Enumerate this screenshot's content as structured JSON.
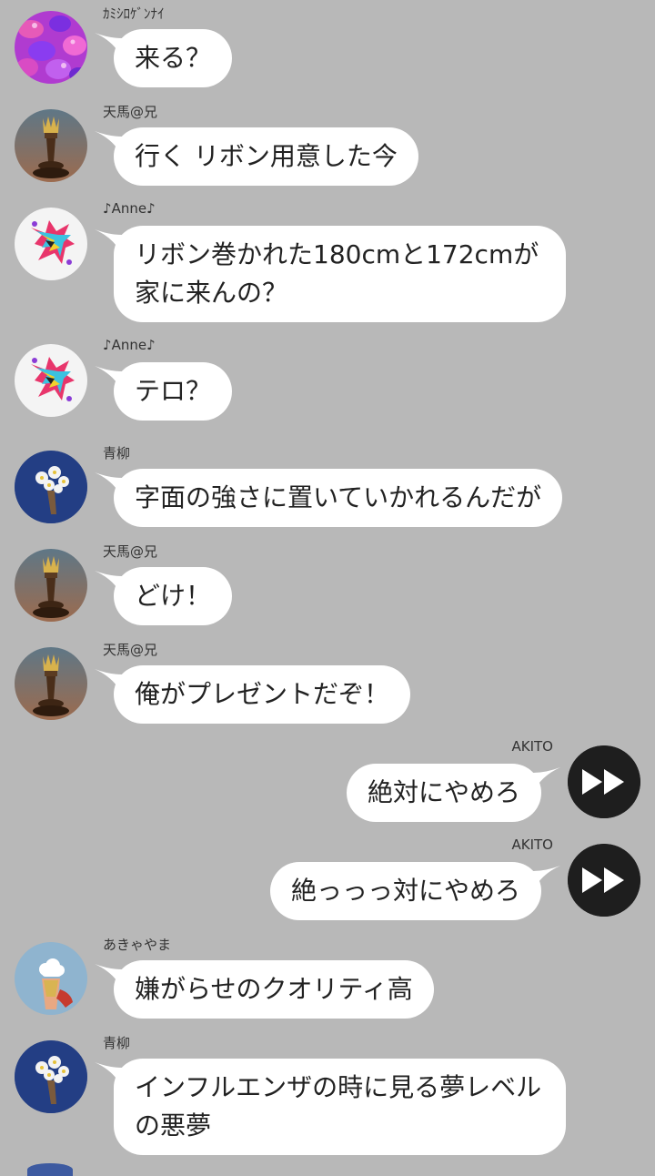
{
  "colors": {
    "background": "#b8b8b8",
    "bubble": "#ffffff",
    "text": "#222222",
    "akito_avatar": "#1e1e1e"
  },
  "messages": [
    {
      "side": "in",
      "sender": "ｶﾐｼﾛｹﾞﾝﾅｲ",
      "avatar": "gummy-bears-avatar",
      "text": "来る？"
    },
    {
      "side": "in",
      "sender": "天馬@兄",
      "avatar": "crown-chess-piece-avatar",
      "text": "行く リボン用意した今"
    },
    {
      "side": "in",
      "sender": "♪Anne♪",
      "avatar": "colorful-art-avatar",
      "text": "リボン巻かれた180cmと172cmが\n家に来んの？"
    },
    {
      "side": "in",
      "sender": "♪Anne♪",
      "avatar": "colorful-art-avatar",
      "text": "テロ？"
    },
    {
      "side": "in",
      "sender": "青柳",
      "avatar": "white-flowers-avatar",
      "text": "字面の強さに置いていかれるんだが"
    },
    {
      "side": "in",
      "sender": "天馬@兄",
      "avatar": "crown-chess-piece-avatar",
      "text": "どけ！"
    },
    {
      "side": "in",
      "sender": "天馬@兄",
      "avatar": "crown-chess-piece-avatar",
      "text": "俺がプレゼントだぞ！"
    },
    {
      "side": "out",
      "sender": "AKITO",
      "avatar": "fast-forward-avatar",
      "text": "絶対にやめろ"
    },
    {
      "side": "out",
      "sender": "AKITO",
      "avatar": "fast-forward-avatar",
      "text": "絶っっっ対にやめろ"
    },
    {
      "side": "in",
      "sender": "あきゃやま",
      "avatar": "hand-cloud-avatar",
      "text": "嫌がらせのクオリティ高"
    },
    {
      "side": "in",
      "sender": "青柳",
      "avatar": "white-flowers-avatar",
      "text": "インフルエンザの時に見る夢レベル\nの悪夢"
    }
  ]
}
